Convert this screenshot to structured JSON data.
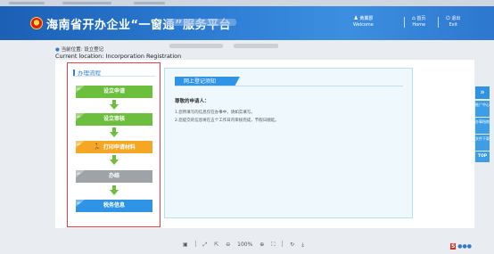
{
  "header": {
    "title": "海南省开办企业“一窗通”服务平台",
    "user": {
      "name": "黄翼郡",
      "welcome": "Welcome"
    },
    "home": {
      "zh": "首页",
      "en": "Home"
    },
    "exit": {
      "zh": "退出",
      "en": "Exit"
    }
  },
  "location": {
    "zh": "当前位置: 设立登记",
    "en": "Current location: Incorporation Registration"
  },
  "flow": {
    "title": "办理流程",
    "steps": [
      {
        "label": "设立申请",
        "tag": "step",
        "color": "#6cbf3c"
      },
      {
        "label": "设立审核",
        "tag": "step",
        "color": "#6cbf3c"
      },
      {
        "label": "打印申请材料",
        "tag": "step",
        "color": "#f5a623"
      },
      {
        "label": "办结",
        "tag": "step",
        "color": "#9ea3a8"
      },
      {
        "label": "税务信息",
        "tag": "step",
        "color": "#2f94e6"
      }
    ]
  },
  "notice": {
    "title": "网上登记须知",
    "greeting": "尊敬的申请人：",
    "lines": [
      "1.您所填写的信息仅在办事中，请如实填写。",
      "2.您提交的信息将在五个工作日内审核完成，节假日顺延。"
    ]
  },
  "sidebar": {
    "collapse": "»",
    "items": [
      "推广中心",
      "办事指南",
      "文件下载"
    ],
    "top": "TOP"
  },
  "toolbar": {
    "zoom": "100%"
  },
  "colors": {
    "header_blue": "#2b7bd3",
    "accent_red": "#e84040",
    "step_green": "#6cbf3c",
    "step_orange": "#f5a623",
    "step_blue": "#2f94e6"
  }
}
